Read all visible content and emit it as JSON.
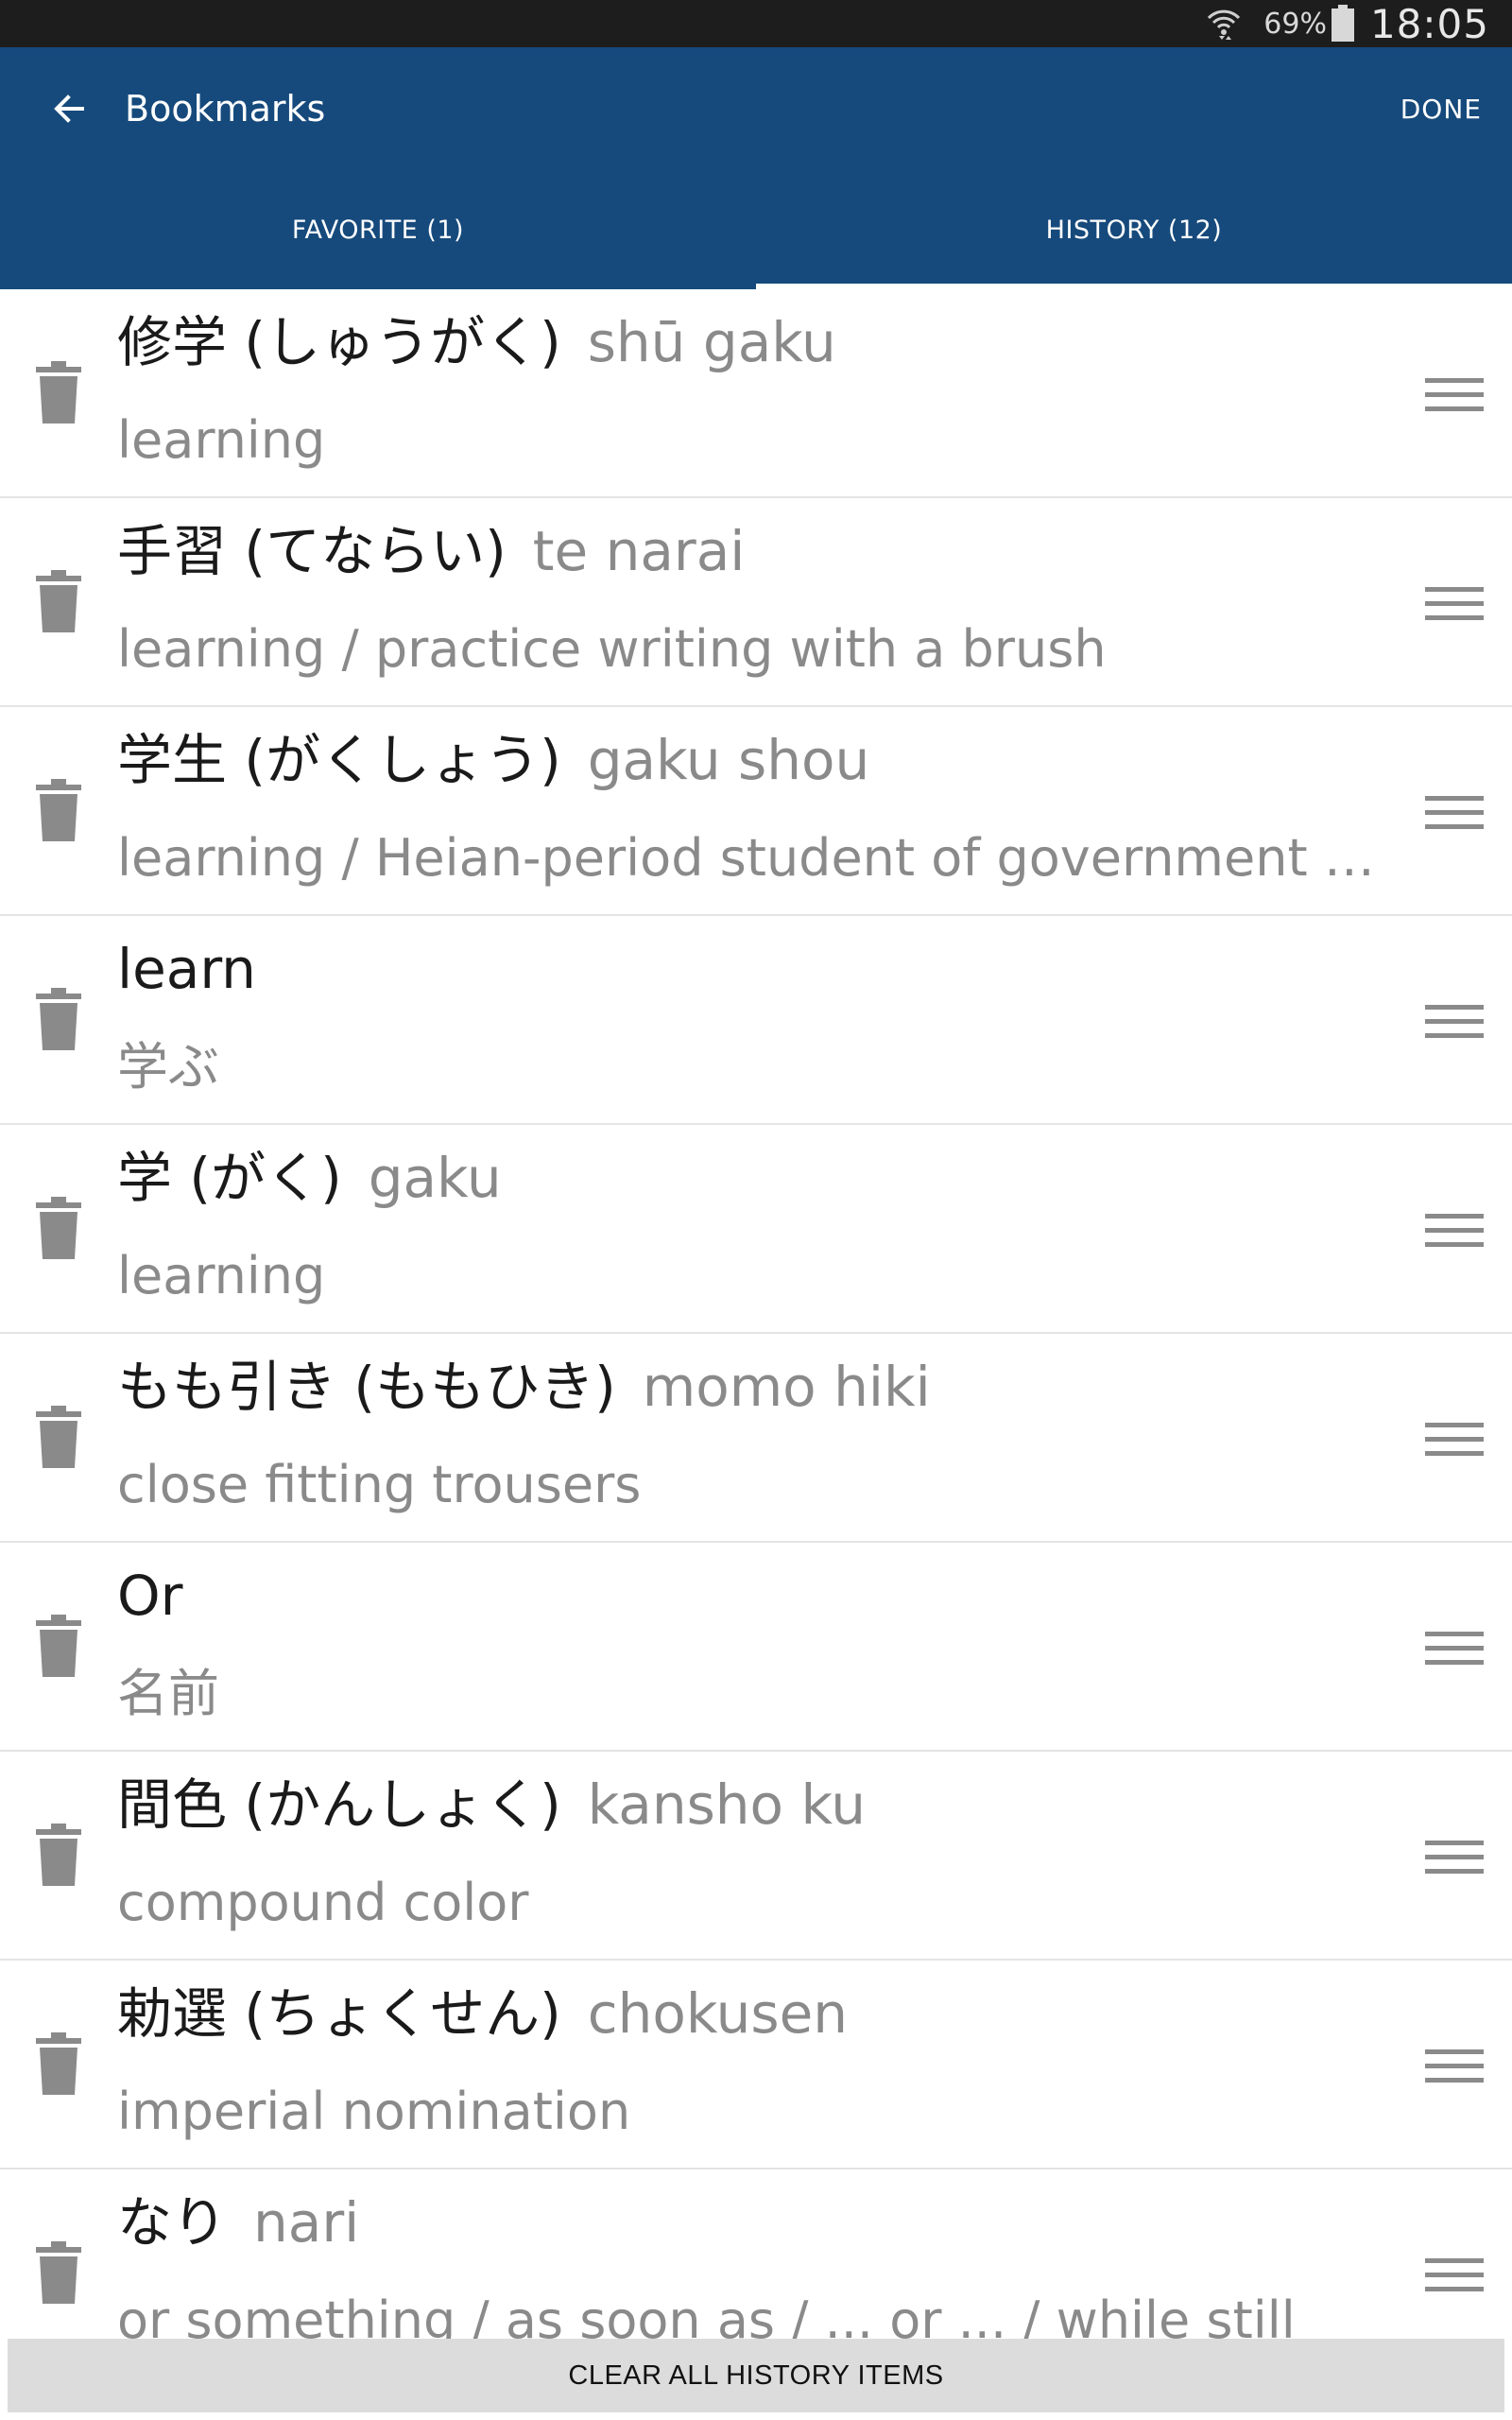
{
  "status_bar": {
    "battery": "69%",
    "time": "18:05",
    "icons": [
      "wifi-icon",
      "battery-icon"
    ]
  },
  "app_bar": {
    "title": "Bookmarks",
    "done_label": "DONE",
    "back_icon": "arrow-left-icon"
  },
  "tabs": [
    {
      "label": "FAVORITE (1)",
      "active": false
    },
    {
      "label": "HISTORY (12)",
      "active": true
    }
  ],
  "history": [
    {
      "term": "修学 (しゅうがく)",
      "reading": "shū gaku",
      "meaning": "learning"
    },
    {
      "term": "手習 (てならい)",
      "reading": "te narai",
      "meaning": "learning / practice writing with a brush"
    },
    {
      "term": "学生 (がくしょう)",
      "reading": "gaku shou",
      "meaning": "learning / Heian-period student of government admi…"
    },
    {
      "term": "learn",
      "reading": "",
      "meaning": "学ぶ"
    },
    {
      "term": "学 (がく)",
      "reading": "gaku",
      "meaning": "learning"
    },
    {
      "term": "もも引き (ももひき)",
      "reading": "momo hiki",
      "meaning": "close fitting trousers"
    },
    {
      "term": "Or",
      "reading": "",
      "meaning": "名前"
    },
    {
      "term": "間色 (かんしょく)",
      "reading": "kansho ku",
      "meaning": "compound color"
    },
    {
      "term": "勅選 (ちょくせん)",
      "reading": "chokusen",
      "meaning": "imperial nomination"
    },
    {
      "term": "なり",
      "reading": "nari",
      "meaning": "or something / as soon as / ... or ... / while still"
    }
  ],
  "clear_button_label": "CLEAR ALL HISTORY ITEMS",
  "colors": {
    "app_bar": "#164a7c",
    "status_bar": "#1d1d1d",
    "icon_gray": "#8a8a8a"
  }
}
